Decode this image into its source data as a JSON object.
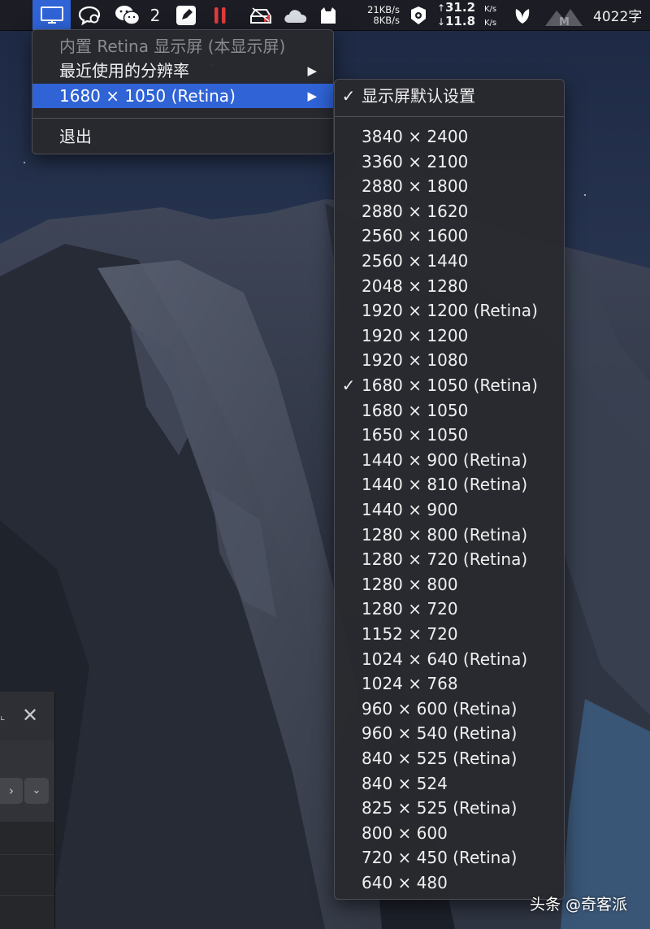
{
  "menubar": {
    "wechat_count": "2",
    "net_down_rate": "21KB/s",
    "net_up_rate": "8KB/s",
    "speed_up_value": "31.2",
    "speed_up_unit": "K/s",
    "speed_down_value": "11.8",
    "speed_down_unit": "K/s",
    "word_count": "4022字",
    "icons": [
      "display-menu-icon",
      "chat-icon",
      "wechat-icon",
      "note-icon",
      "pause-icon",
      "disk-icon",
      "cloud-icon",
      "cat-icon",
      "shield-icon",
      "leaf-icon",
      "mountain-icon"
    ],
    "accent_color": "#2f63d6"
  },
  "main_menu": {
    "header": "内置 Retina 显示屏 (本显示屏)",
    "recent": "最近使用的分辨率",
    "current": "1680 × 1050 (Retina)",
    "quit": "退出",
    "submenu_arrow": "▶"
  },
  "sub_menu": {
    "default_label": "显示屏默认设置",
    "default_checked": true,
    "check_mark": "✓",
    "resolutions": [
      {
        "label": "3840 × 2400",
        "checked": false
      },
      {
        "label": "3360 × 2100",
        "checked": false
      },
      {
        "label": "2880 × 1800",
        "checked": false
      },
      {
        "label": "2880 × 1620",
        "checked": false
      },
      {
        "label": "2560 × 1600",
        "checked": false
      },
      {
        "label": "2560 × 1440",
        "checked": false
      },
      {
        "label": "2048 × 1280",
        "checked": false
      },
      {
        "label": "1920 × 1200 (Retina)",
        "checked": false
      },
      {
        "label": "1920 × 1200",
        "checked": false
      },
      {
        "label": "1920 × 1080",
        "checked": false
      },
      {
        "label": "1680 × 1050 (Retina)",
        "checked": true
      },
      {
        "label": "1680 × 1050",
        "checked": false
      },
      {
        "label": "1650 × 1050",
        "checked": false
      },
      {
        "label": "1440 × 900 (Retina)",
        "checked": false
      },
      {
        "label": "1440 × 810 (Retina)",
        "checked": false
      },
      {
        "label": "1440 × 900",
        "checked": false
      },
      {
        "label": "1280 × 800 (Retina)",
        "checked": false
      },
      {
        "label": "1280 × 720 (Retina)",
        "checked": false
      },
      {
        "label": "1280 × 800",
        "checked": false
      },
      {
        "label": "1280 × 720",
        "checked": false
      },
      {
        "label": "1152 × 720",
        "checked": false
      },
      {
        "label": "1024 × 640 (Retina)",
        "checked": false
      },
      {
        "label": "1024 × 768",
        "checked": false
      },
      {
        "label": "960 × 600 (Retina)",
        "checked": false
      },
      {
        "label": "960 × 540 (Retina)",
        "checked": false
      },
      {
        "label": "840 × 525 (Retina)",
        "checked": false
      },
      {
        "label": "840 × 524",
        "checked": false
      },
      {
        "label": "825 × 525 (Retina)",
        "checked": false
      },
      {
        "label": "800 × 600",
        "checked": false
      },
      {
        "label": "720 × 450 (Retina)",
        "checked": false
      },
      {
        "label": "640 × 480",
        "checked": false
      }
    ]
  },
  "side_window": {
    "close_glyph": "✕",
    "forward_glyph": "›",
    "dropdown_glyph": "⌄"
  },
  "watermark": "头条 @奇客派"
}
